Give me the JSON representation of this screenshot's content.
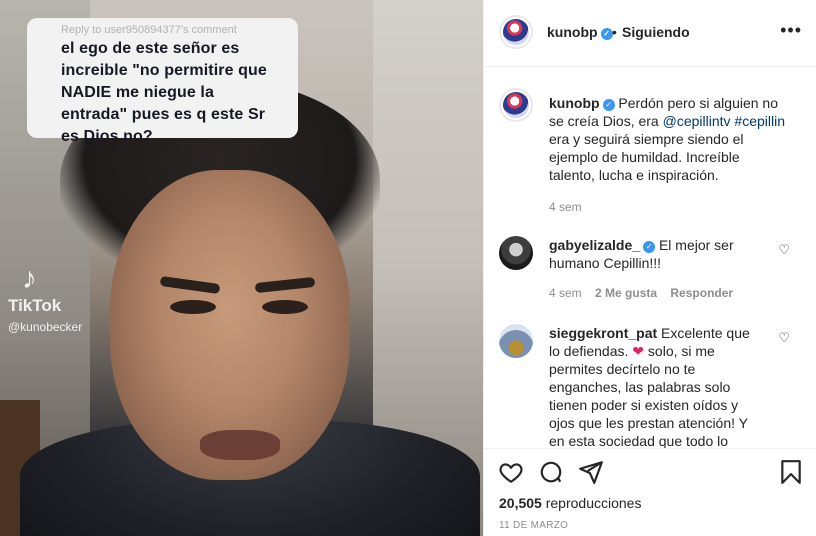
{
  "video": {
    "reply_header": "Reply to user950894377's comment",
    "reply_text": "el ego de este señor es increible \"no permitire que NADIE me niegue la entrada\" pues es q este Sr es Dios no?",
    "watermark_brand": "TikTok",
    "watermark_user": "@kunobecker"
  },
  "header": {
    "username": "kunobp",
    "separator": "•",
    "follow_status": "Siguiendo",
    "more": "•••"
  },
  "caption": {
    "username": "kunobp",
    "text_before": " Perdón pero si alguien no se creía Dios, era ",
    "mention": "@cepillintv",
    "space": " ",
    "hashtag": "#cepillin",
    "text_after": " era y seguirá siempre siendo el ejemplo de humildad. Increíble talento, lucha e inspiración.",
    "time": "4 sem"
  },
  "comments": [
    {
      "username": "gabyelizalde_",
      "text": "El mejor ser humano Cepillin!!!",
      "time": "4 sem",
      "likes": "2 Me gusta",
      "reply": "Responder"
    },
    {
      "username": "sieggekront_pat",
      "text_before": " Excelente que lo defiendas. ",
      "emoji": "❤",
      "text_after": " solo, si me permites decírtelo no te enganches, las palabras solo tienen poder si existen oídos y ojos que les prestan atención! Y en esta sociedad que todo lo"
    }
  ],
  "footer": {
    "views_count": "20,505",
    "views_label": "reproducciones",
    "date": "11 DE MARZO"
  },
  "colors": {
    "verified": "#3897f0",
    "link": "#00376b",
    "muted": "#8e8e8e",
    "heart_emoji": "#e0245e"
  }
}
